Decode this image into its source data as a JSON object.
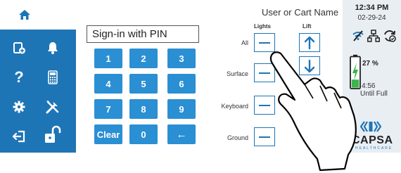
{
  "pin": {
    "placeholder": "Sign-in with PIN"
  },
  "keypad": [
    "1",
    "2",
    "3",
    "4",
    "5",
    "6",
    "7",
    "8",
    "9",
    "Clear",
    "0",
    "←"
  ],
  "cart": {
    "name": "User or Cart Name",
    "col_lights": "Lights",
    "col_lift": "Lift",
    "rows": [
      "All",
      "Surface",
      "Keyboard",
      "Ground"
    ]
  },
  "status": {
    "time": "12:34 PM",
    "date": "02-29-24",
    "battery_pct": "27 %",
    "battery_level": 0.27,
    "time_remaining": "4:56",
    "until_label": "Until Full"
  },
  "brand": {
    "name": "CAPSA",
    "sub": "HEALTHCARE"
  },
  "colors": {
    "accent": "#1e75b6",
    "key": "#2a8fd3",
    "charging": "#3ab54a"
  },
  "icons": [
    "home-icon",
    "add-note-icon",
    "bell-icon",
    "help-icon",
    "calculator-icon",
    "gear-icon",
    "tools-icon",
    "logout-icon",
    "unlock-icon",
    "arrow-up-icon",
    "arrow-down-icon",
    "minus-icon",
    "wifi-off-icon",
    "network-icon",
    "sync-icon",
    "battery-icon",
    "charging-bolt-icon",
    "capsa-logo-icon",
    "hand-pointer-icon"
  ]
}
